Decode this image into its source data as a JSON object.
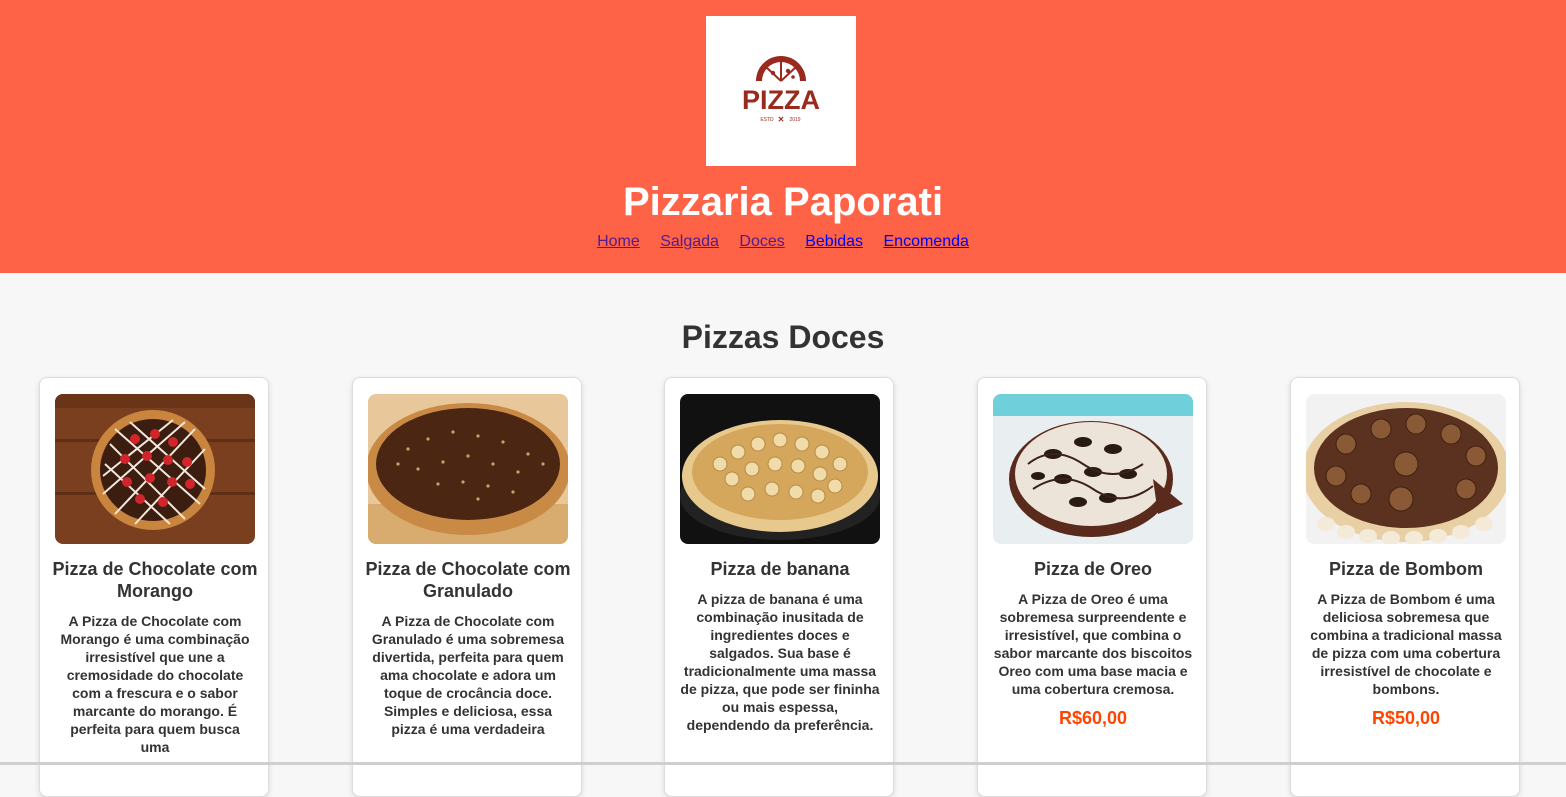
{
  "header": {
    "logo_text": "PIZZA",
    "logo_est": "ESTD",
    "logo_year": "2019",
    "title": "Pizzaria Paporati",
    "nav": [
      "Home",
      "Salgada",
      "Doces",
      "Bebidas",
      "Encomenda"
    ]
  },
  "section": {
    "title": "Pizzas Doces"
  },
  "cards": [
    {
      "name": "Pizza de Chocolate com Morango",
      "description": "A Pizza de Chocolate com Morango é uma combinação irresistível que une a cremosidade do chocolate com a frescura e o sabor marcante do morango. É perfeita para quem busca uma",
      "price": ""
    },
    {
      "name": "Pizza de Chocolate com Granulado",
      "description": "A Pizza de Chocolate com Granulado é uma sobremesa divertida, perfeita para quem ama chocolate e adora um toque de crocância doce. Simples e deliciosa, essa pizza é uma verdadeira",
      "price": ""
    },
    {
      "name": "Pizza de banana",
      "description": "A pizza de banana é uma combinação inusitada de ingredientes doces e salgados. Sua base é tradicionalmente uma massa de pizza, que pode ser fininha ou mais espessa, dependendo da preferência.",
      "price": ""
    },
    {
      "name": "Pizza de Oreo",
      "description": "A Pizza de Oreo é uma sobremesa surpreendente e irresistível, que combina o sabor marcante dos biscoitos Oreo com uma base macia e uma cobertura cremosa.",
      "price": "R$60,00"
    },
    {
      "name": "Pizza de Bombom",
      "description": "A Pizza de Bombom é uma deliciosa sobremesa que combina a tradicional massa de pizza com uma cobertura irresistível de chocolate e bombons.",
      "price": "R$50,00"
    }
  ],
  "colors": {
    "header_bg": "#ff6347",
    "page_bg": "#f7f7f7",
    "price": "#ff4500",
    "logo": "#9b2a1e"
  },
  "icons": [
    "pizza-logo-icon"
  ]
}
